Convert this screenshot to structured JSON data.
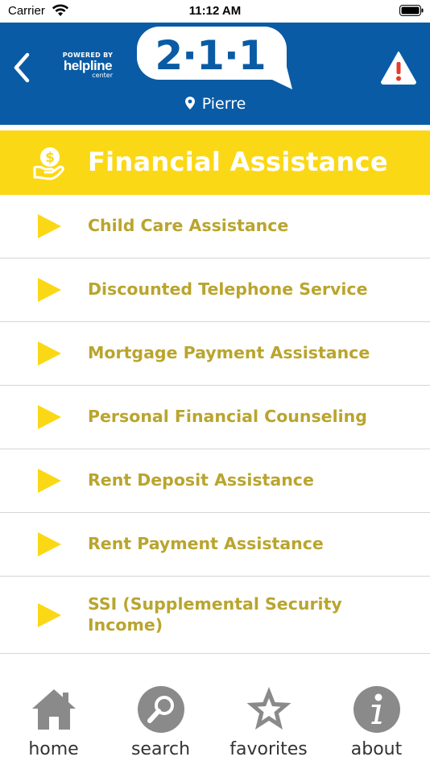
{
  "status_bar": {
    "carrier": "Carrier",
    "time": "11:12 AM"
  },
  "header": {
    "powered_by": "POWERED BY",
    "brand": "helpline",
    "brand_sub": "center",
    "logo": "2·1·1",
    "location": "Pierre",
    "back_icon": "chevron-left-icon",
    "alert_icon": "warning-triangle-icon"
  },
  "category": {
    "title": "Financial Assistance",
    "icon": "dollar-hand-icon"
  },
  "items": [
    {
      "label": "Child Care Assistance"
    },
    {
      "label": "Discounted Telephone Service"
    },
    {
      "label": "Mortgage Payment Assistance"
    },
    {
      "label": "Personal Financial Counseling"
    },
    {
      "label": "Rent Deposit Assistance"
    },
    {
      "label": "Rent Payment Assistance"
    },
    {
      "label": "SSI (Supplemental Security Income)"
    }
  ],
  "tabs": [
    {
      "label": "home",
      "icon": "house-icon"
    },
    {
      "label": "search",
      "icon": "magnifier-icon"
    },
    {
      "label": "favorites",
      "icon": "star-icon"
    },
    {
      "label": "about",
      "icon": "info-icon"
    }
  ],
  "colors": {
    "header_blue": "#0a5ba5",
    "banner_yellow": "#fbd816",
    "item_text": "#b9a52e",
    "alert_red": "#e53b2a",
    "tab_gray": "#8a8a8a"
  }
}
